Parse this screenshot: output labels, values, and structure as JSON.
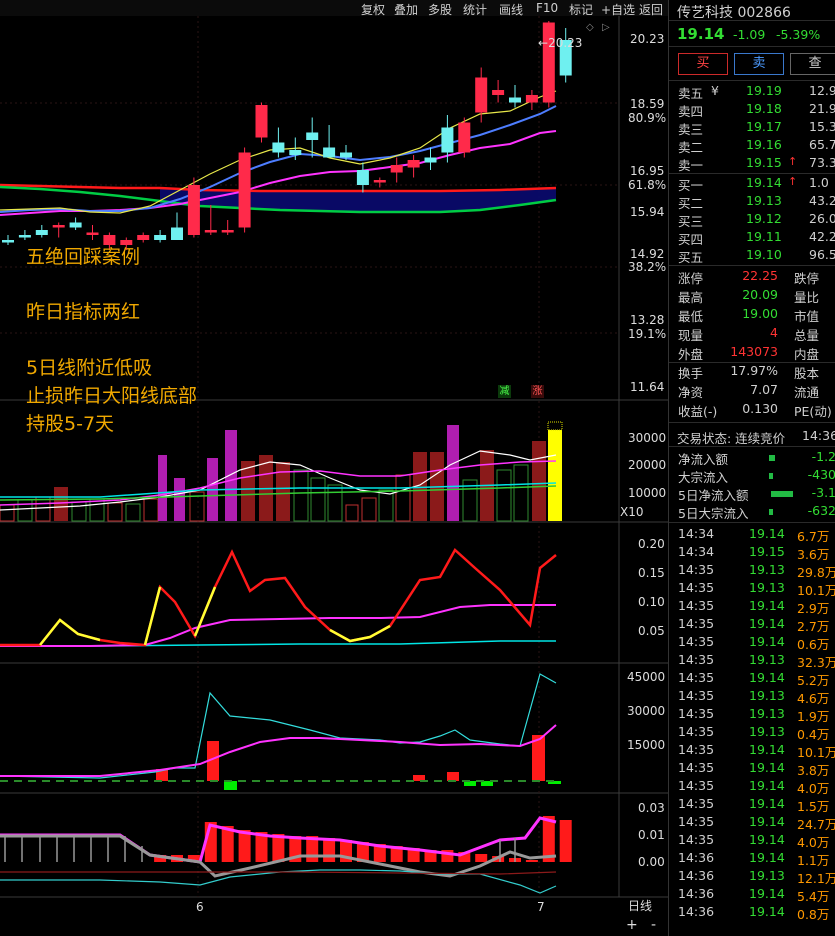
{
  "toolbar": [
    "复权",
    "叠加",
    "多股",
    "统计",
    "画线",
    "F10",
    "标记",
    "+自选",
    "返回"
  ],
  "annotations": {
    "line1": "五绝回踩案例",
    "line2": "昨日指标两红",
    "line3": "5日线附近低吸",
    "line4": "止损昨日大阳线底部",
    "line5": "持股5-7天",
    "tag_green": "减",
    "tag_red": "涨"
  },
  "main_axis": {
    "p1": "20.23",
    "p2": "18.59",
    "pc2": "80.9%",
    "p3": "16.95",
    "pc3": "61.8%",
    "p4": "15.94",
    "p5": "14.92",
    "pc5": "38.2%",
    "p6": "13.28",
    "pc6": "19.1%",
    "p7": "11.64",
    "high_label": "20.23"
  },
  "vol_axis": {
    "v1": "30000",
    "v2": "20000",
    "v3": "10000",
    "unit": "X10"
  },
  "ind2_axis": {
    "a1": "0.20",
    "a2": "0.15",
    "a3": "0.10",
    "a4": "0.05"
  },
  "ind3_axis": {
    "a1": "45000",
    "a2": "30000",
    "a3": "15000"
  },
  "ind4_axis": {
    "a1": "0.03",
    "a2": "0.01",
    "a3": "0.00"
  },
  "date_axis": {
    "d1": "6",
    "d2": "7",
    "period": "日线",
    "plus": "+",
    "minus": "-"
  },
  "stock": {
    "name": "传艺科技",
    "code": "002866",
    "price": "19.14",
    "change": "-1.09",
    "pct": "-5.39%"
  },
  "buttons": {
    "buy": "买",
    "sell": "卖",
    "query": "查"
  },
  "order_book": [
    {
      "label": "卖五",
      "mark": "¥",
      "price": "19.19",
      "vol": "12.9",
      "arrow": ""
    },
    {
      "label": "卖四",
      "mark": "",
      "price": "19.18",
      "vol": "21.9",
      "arrow": ""
    },
    {
      "label": "卖三",
      "mark": "",
      "price": "19.17",
      "vol": "15.3",
      "arrow": ""
    },
    {
      "label": "卖二",
      "mark": "",
      "price": "19.16",
      "vol": "65.7",
      "arrow": ""
    },
    {
      "label": "卖一",
      "mark": "",
      "price": "19.15",
      "vol": "73.3",
      "arrow": "↑"
    },
    {
      "label": "买一",
      "mark": "",
      "price": "19.14",
      "vol": "1.0",
      "arrow": "↑"
    },
    {
      "label": "买二",
      "mark": "",
      "price": "19.13",
      "vol": "43.2",
      "arrow": ""
    },
    {
      "label": "买三",
      "mark": "",
      "price": "19.12",
      "vol": "26.0",
      "arrow": ""
    },
    {
      "label": "买四",
      "mark": "",
      "price": "19.11",
      "vol": "42.2",
      "arrow": ""
    },
    {
      "label": "买五",
      "mark": "",
      "price": "19.10",
      "vol": "96.5",
      "arrow": ""
    }
  ],
  "stats": [
    {
      "l": "涨停",
      "v": "22.25",
      "r": "跌停",
      "c": "#ff3333"
    },
    {
      "l": "最高",
      "v": "20.09",
      "r": "量比",
      "c": "#33dd33"
    },
    {
      "l": "最低",
      "v": "19.00",
      "r": "市值",
      "c": "#33dd33"
    },
    {
      "l": "现量",
      "v": "4",
      "r": "总量",
      "c": "#ff3333"
    },
    {
      "l": "外盘",
      "v": "143073",
      "r": "内盘",
      "c": "#ff3333"
    }
  ],
  "stats2": [
    {
      "l": "换手",
      "v": "17.97%",
      "r": "股本"
    },
    {
      "l": "净资",
      "v": "7.07",
      "r": "流通"
    },
    {
      "l": "收益(-)",
      "v": "0.130",
      "r": "PE(动)"
    }
  ],
  "status": {
    "label": "交易状态: 连续竞价",
    "time": "14:36"
  },
  "flows": [
    {
      "l": "净流入额",
      "v": "-1.2"
    },
    {
      "l": "大宗流入",
      "v": "-430"
    },
    {
      "l": "5日净流入额",
      "v": "-3.1"
    },
    {
      "l": "5日大宗流入",
      "v": "-632"
    }
  ],
  "ticks": [
    {
      "t": "14:34",
      "p": "19.14",
      "v": "6.7万"
    },
    {
      "t": "14:34",
      "p": "19.15",
      "v": "3.6万"
    },
    {
      "t": "14:35",
      "p": "19.13",
      "v": "29.8万"
    },
    {
      "t": "14:35",
      "p": "19.13",
      "v": "10.1万"
    },
    {
      "t": "14:35",
      "p": "19.14",
      "v": "2.9万"
    },
    {
      "t": "14:35",
      "p": "19.14",
      "v": "2.7万"
    },
    {
      "t": "14:35",
      "p": "19.14",
      "v": "0.6万"
    },
    {
      "t": "14:35",
      "p": "19.13",
      "v": "32.3万"
    },
    {
      "t": "14:35",
      "p": "19.14",
      "v": "5.2万"
    },
    {
      "t": "14:35",
      "p": "19.13",
      "v": "4.6万"
    },
    {
      "t": "14:35",
      "p": "19.13",
      "v": "1.9万"
    },
    {
      "t": "14:35",
      "p": "19.13",
      "v": "0.4万"
    },
    {
      "t": "14:35",
      "p": "19.14",
      "v": "10.1万"
    },
    {
      "t": "14:35",
      "p": "19.14",
      "v": "3.8万"
    },
    {
      "t": "14:35",
      "p": "19.14",
      "v": "4.0万"
    },
    {
      "t": "14:35",
      "p": "19.14",
      "v": "1.5万"
    },
    {
      "t": "14:35",
      "p": "19.14",
      "v": "24.7万"
    },
    {
      "t": "14:35",
      "p": "19.14",
      "v": "4.0万"
    },
    {
      "t": "14:36",
      "p": "19.14",
      "v": "1.1万"
    },
    {
      "t": "14:36",
      "p": "19.13",
      "v": "12.1万"
    },
    {
      "t": "14:36",
      "p": "19.14",
      "v": "5.4万"
    },
    {
      "t": "14:36",
      "p": "19.14",
      "v": "0.8万"
    }
  ],
  "chart_data": {
    "type": "candlestick",
    "price_axis_ticks": [
      20.23,
      18.59,
      16.95,
      15.94,
      14.92,
      13.28,
      11.64
    ],
    "candles": [
      {
        "o": 15.85,
        "h": 15.95,
        "l": 15.75,
        "c": 15.8
      },
      {
        "o": 15.95,
        "h": 16.05,
        "l": 15.85,
        "c": 15.9
      },
      {
        "o": 16.05,
        "h": 16.15,
        "l": 15.9,
        "c": 15.95
      },
      {
        "o": 16.1,
        "h": 16.2,
        "l": 15.9,
        "c": 16.15
      },
      {
        "o": 16.2,
        "h": 16.3,
        "l": 16.05,
        "c": 16.1
      },
      {
        "o": 15.95,
        "h": 16.15,
        "l": 15.85,
        "c": 16.0
      },
      {
        "o": 15.75,
        "h": 16.0,
        "l": 15.65,
        "c": 15.95
      },
      {
        "o": 15.75,
        "h": 15.9,
        "l": 15.65,
        "c": 15.85
      },
      {
        "o": 15.85,
        "h": 16.0,
        "l": 15.8,
        "c": 15.95
      },
      {
        "o": 15.95,
        "h": 16.05,
        "l": 15.8,
        "c": 15.85
      },
      {
        "o": 16.1,
        "h": 16.4,
        "l": 15.9,
        "c": 15.85
      },
      {
        "o": 15.95,
        "h": 17.1,
        "l": 15.9,
        "c": 16.95
      },
      {
        "o": 16.0,
        "h": 16.55,
        "l": 15.95,
        "c": 16.05
      },
      {
        "o": 16.0,
        "h": 16.25,
        "l": 15.95,
        "c": 16.05
      },
      {
        "o": 16.1,
        "h": 17.7,
        "l": 16.0,
        "c": 17.6
      },
      {
        "o": 17.9,
        "h": 18.6,
        "l": 17.8,
        "c": 18.55
      },
      {
        "o": 17.8,
        "h": 18.1,
        "l": 17.5,
        "c": 17.6
      },
      {
        "o": 17.65,
        "h": 17.9,
        "l": 17.45,
        "c": 17.55
      },
      {
        "o": 18.0,
        "h": 18.3,
        "l": 17.5,
        "c": 17.85
      },
      {
        "o": 17.7,
        "h": 18.15,
        "l": 17.5,
        "c": 17.5
      },
      {
        "o": 17.6,
        "h": 17.75,
        "l": 17.45,
        "c": 17.5
      },
      {
        "o": 17.25,
        "h": 17.4,
        "l": 16.8,
        "c": 16.95
      },
      {
        "o": 17.0,
        "h": 17.1,
        "l": 16.9,
        "c": 17.05
      },
      {
        "o": 17.2,
        "h": 17.5,
        "l": 17.0,
        "c": 17.35
      },
      {
        "o": 17.3,
        "h": 17.55,
        "l": 17.1,
        "c": 17.45
      },
      {
        "o": 17.5,
        "h": 17.7,
        "l": 17.25,
        "c": 17.4
      },
      {
        "o": 18.1,
        "h": 18.35,
        "l": 17.4,
        "c": 17.6
      },
      {
        "o": 17.6,
        "h": 18.3,
        "l": 17.5,
        "c": 18.2
      },
      {
        "o": 18.4,
        "h": 19.3,
        "l": 18.2,
        "c": 19.1
      },
      {
        "o": 18.75,
        "h": 19.05,
        "l": 18.6,
        "c": 18.85
      },
      {
        "o": 18.7,
        "h": 18.95,
        "l": 18.5,
        "c": 18.6
      },
      {
        "o": 18.6,
        "h": 18.85,
        "l": 18.45,
        "c": 18.75
      },
      {
        "o": 18.6,
        "h": 20.23,
        "l": 18.5,
        "c": 20.2
      },
      {
        "o": 19.85,
        "h": 20.09,
        "l": 19.0,
        "c": 19.14
      }
    ]
  }
}
